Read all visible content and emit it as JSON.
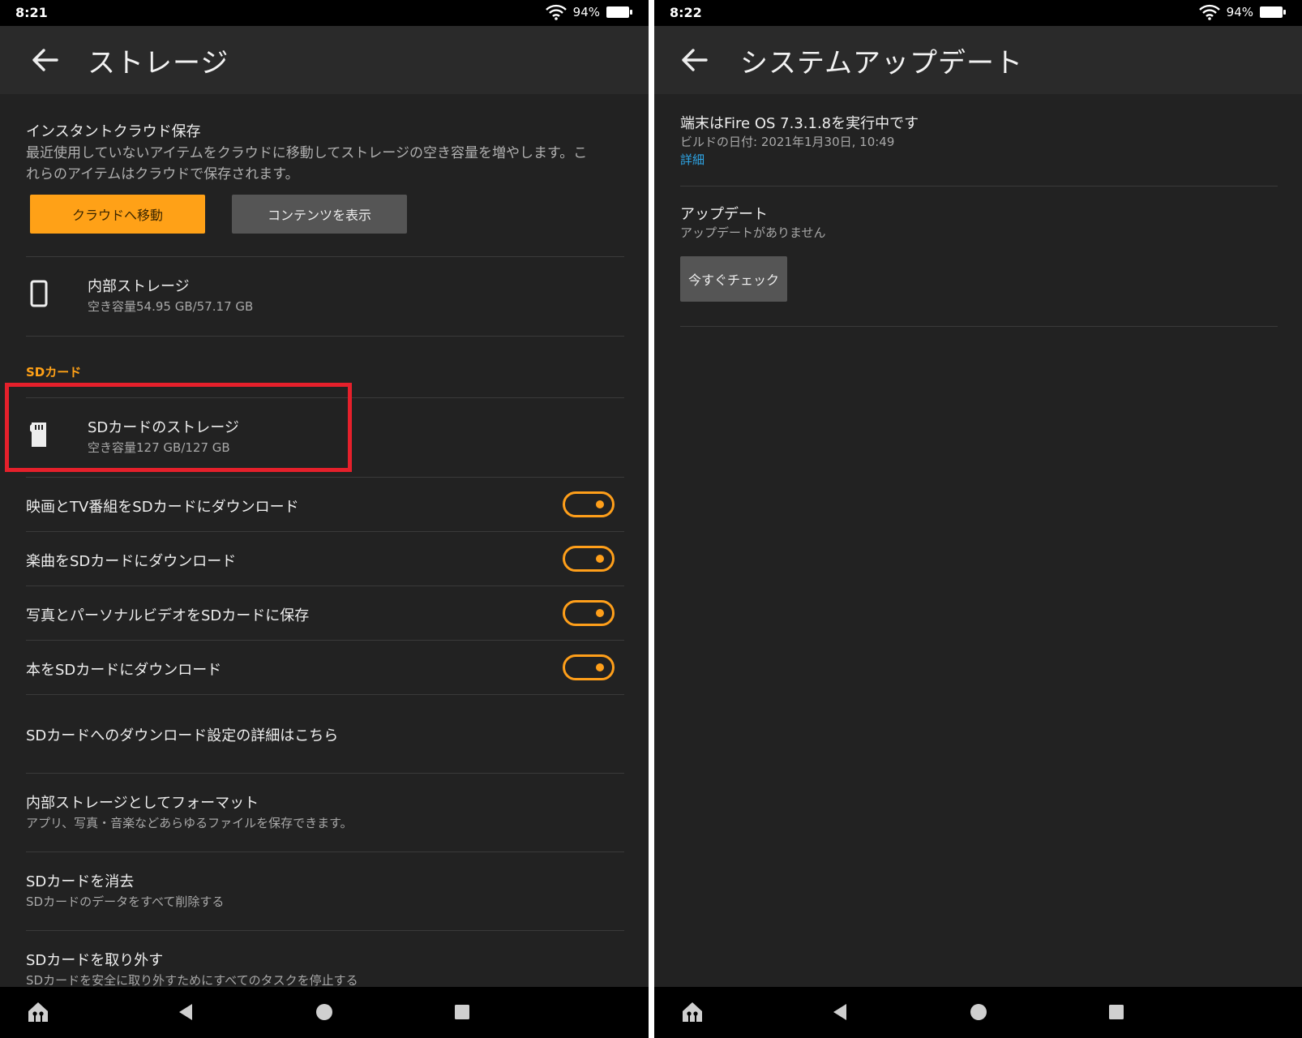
{
  "left_screen": {
    "status": {
      "time": "8:21",
      "battery": "94%"
    },
    "title": "ストレージ",
    "cloud": {
      "title": "インスタントクラウド保存",
      "desc_line1": "最近使用していないアイテムをクラウドに移動してストレージの空き容量を増やします。こ",
      "desc_line2": "れらのアイテムはクラウドで保存されます。",
      "move_button": "クラウドへ移動",
      "view_button": "コンテンツを表示"
    },
    "internal": {
      "title": "内部ストレージ",
      "sub": "空き容量54.95 GB/57.17 GB"
    },
    "sd_section_header": "SDカード",
    "sd_storage": {
      "title": "SDカードのストレージ",
      "sub": "空き容量127 GB/127 GB"
    },
    "toggles": [
      {
        "label": "映画とTV番組をSDカードにダウンロード",
        "on": true
      },
      {
        "label": "楽曲をSDカードにダウンロード",
        "on": true
      },
      {
        "label": "写真とパーソナルビデオをSDカードに保存",
        "on": true
      },
      {
        "label": "本をSDカードにダウンロード",
        "on": true
      }
    ],
    "details_link": "SDカードへのダウンロード設定の詳細はこちら",
    "format": {
      "title": "内部ストレージとしてフォーマット",
      "sub": "アプリ、写真・音楽などあらゆるファイルを保存できます。"
    },
    "erase": {
      "title": "SDカードを消去",
      "sub": "SDカードのデータをすべて削除する"
    },
    "eject": {
      "title": "SDカードを取り外す",
      "sub": "SDカードを安全に取り外すためにすべてのタスクを停止する"
    }
  },
  "right_screen": {
    "status": {
      "time": "8:22",
      "battery": "94%"
    },
    "title": "システムアップデート",
    "os": {
      "title": "端末はFire OS 7.3.1.8を実行中です",
      "build": "ビルドの日付: 2021年1月30日, 10:49",
      "details_link": "詳細"
    },
    "update": {
      "title": "アップデート",
      "sub": "アップデートがありません",
      "check_button": "今すぐチェック"
    }
  },
  "colors": {
    "accent_orange": "#ffa117",
    "highlight_red": "#e5202b",
    "link_blue": "#2ea5e6",
    "background": "#222222"
  },
  "icons": {
    "back": "back-arrow-icon",
    "phone": "phone-icon",
    "sd": "sd-card-icon",
    "wifi": "wifi-icon",
    "battery": "battery-icon",
    "nav": [
      "home-icon",
      "nav-back-icon",
      "nav-home-circle-icon",
      "recents-icon"
    ]
  }
}
